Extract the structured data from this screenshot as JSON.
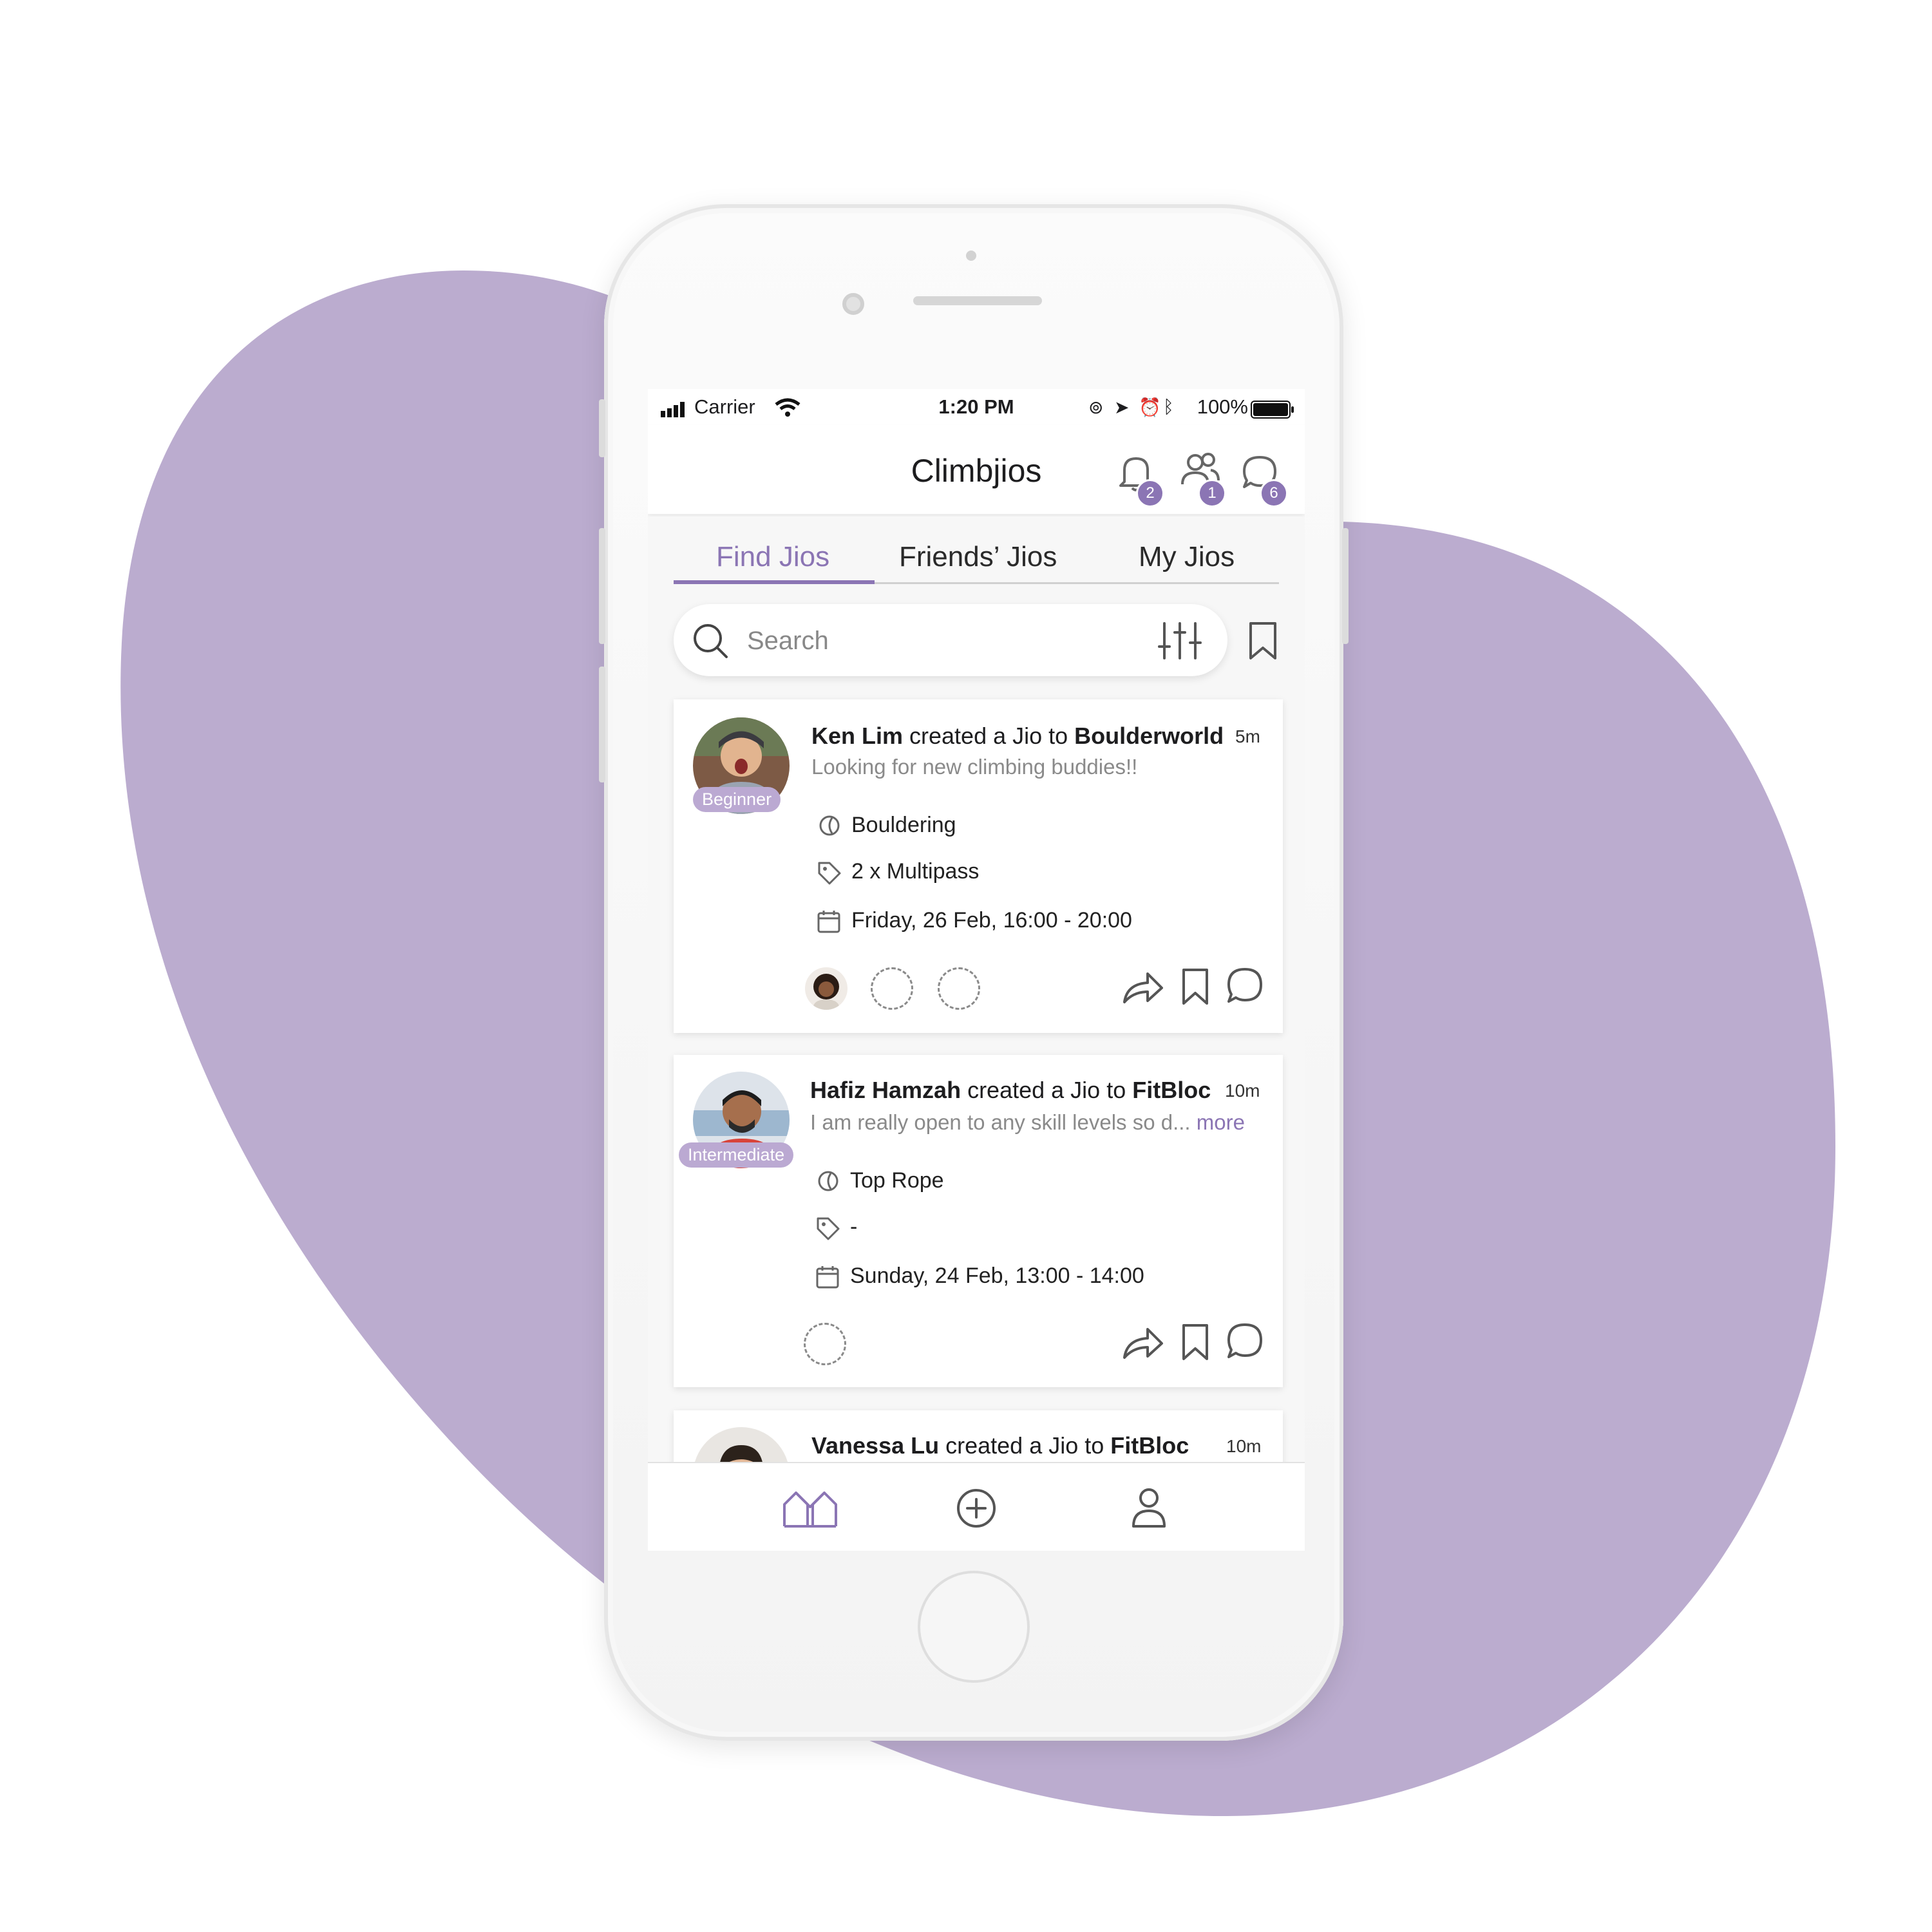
{
  "colors": {
    "accent": "#8b75b4",
    "blob": "#bbaccf",
    "level_badge": "#bba9d2"
  },
  "status_bar": {
    "carrier": "Carrier",
    "time": "1:20 PM",
    "battery": "100%"
  },
  "header": {
    "title": "Climbjios",
    "notifications_count": "2",
    "friends_count": "1",
    "messages_count": "6"
  },
  "tabs": [
    {
      "label": "Find Jios",
      "active": true
    },
    {
      "label": "Friends’ Jios",
      "active": false
    },
    {
      "label": "My Jios",
      "active": false
    }
  ],
  "search": {
    "placeholder": "Search"
  },
  "jios": [
    {
      "user": "Ken Lim",
      "action_text": " created a Jio to ",
      "gym": "Boulderworld",
      "time_ago": "5m",
      "description": "Looking for new climbing buddies!!",
      "more": "",
      "level": "Beginner",
      "type": "Bouldering",
      "pass": "2 x Multipass",
      "datetime": "Friday, 26 Feb, 16:00 - 20:00"
    },
    {
      "user": "Hafiz Hamzah",
      "action_text": " created a Jio to ",
      "gym": "FitBloc",
      "time_ago": "10m",
      "description": "I am really open to any skill levels so d...",
      "more": "more",
      "level": "Intermediate",
      "type": "Top Rope",
      "pass": "-",
      "datetime": "Sunday, 24 Feb, 13:00 - 14:00"
    },
    {
      "user": "Vanessa Lu",
      "action_text": " created a Jio to ",
      "gym": "FitBloc",
      "time_ago": "10m"
    }
  ]
}
